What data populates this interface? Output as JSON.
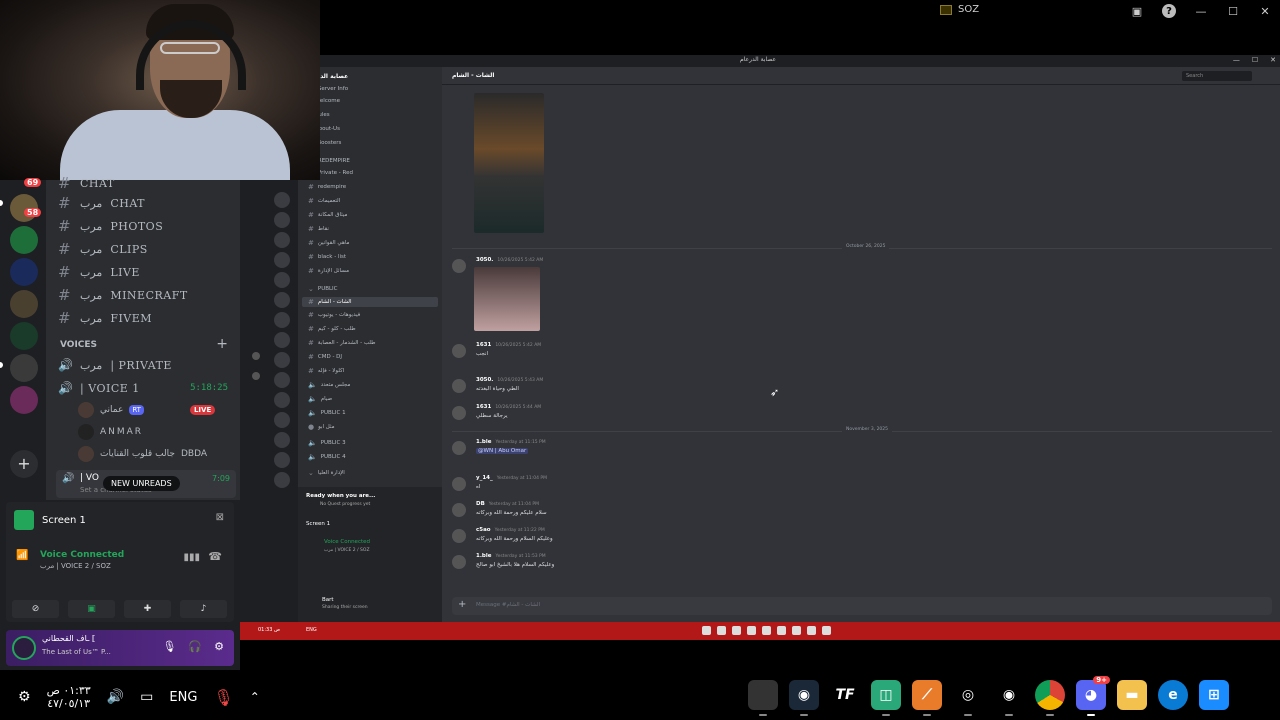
{
  "outer_window": {
    "title": "SOZ"
  },
  "left_panel": {
    "rail_badges": [
      "69",
      "58"
    ],
    "text_channels": [
      "CHAT",
      "CHAT",
      "PHOTOS",
      "CLIPS",
      "LIVE",
      "MINECRAFT",
      "FIVEM"
    ],
    "channel_prefix": "مرب",
    "voices_header": "VOICES",
    "voice_channels": [
      {
        "label": "| PRIVATE",
        "timer": ""
      },
      {
        "label": "| VOICE 1",
        "timer": "5:18:25"
      }
    ],
    "voice_users": [
      {
        "name": "عماني",
        "badge": "RT",
        "live": "LIVE"
      },
      {
        "name": "ANMAR"
      },
      {
        "name": "جالب قلوب القنايات",
        "badge": "DBDA"
      }
    ],
    "status_channel": "| VO",
    "status_timer": "7:09",
    "status_placeholder": "Set a channel status",
    "new_unreads": "NEW UNREADS",
    "screen_title": "Screen 1",
    "voice_connected": "Voice Connected",
    "voice_connected_sub": "مرب | VOICE 2 / SOZ",
    "user_name": "ـاف القحطاني ⟦",
    "user_game": "The Last of Us™ P..."
  },
  "discord_window": {
    "title": "عصابة الدرعام",
    "server_name": "عصابة الدرعام",
    "channels": [
      "Server Info",
      "Welcome",
      "Rules",
      "About-Us",
      "Boosters",
      "REDEMPIRE",
      "Private - Red",
      "redempire",
      "التعميمات",
      "ميثاق المكانة",
      "نقاط",
      "ماهي القوانين",
      "black - list",
      "مسائل الإدارة",
      "PUBLIC",
      "الشات - الشام",
      "فيديوهات - يوتيوب",
      "طلب - كلو - كيم",
      "طلب - الشدمار - العصابة",
      "CMD - DJ",
      "اكلولا - فإله",
      "مجلس متعدد",
      "صيام",
      "PUBLIC 1",
      "مثل ابو",
      "PUBLIC 3",
      "PUBLIC 4",
      "الإدارة العليا"
    ],
    "active_channel": "الشات - الشام",
    "ready_title": "Ready when you are...",
    "ready_sub": "No Quest progress yet",
    "screen": "Screen 1",
    "voice_connected": "Voice Connected",
    "voice_sub": "مرب | VOICE 2 / SOZ",
    "user": "Bart",
    "user_status": "Sharing their screen",
    "chat_header": "الشات - الشام",
    "search_placeholder": "Search",
    "dividers": [
      "October 26, 2025",
      "November 3, 2025"
    ],
    "messages": [
      {
        "name": "3050.",
        "time": "10/26/2025 5:42 AM",
        "text": ""
      },
      {
        "name": "1631",
        "time": "10/26/2025 5:42 AM",
        "text": "انجب"
      },
      {
        "name": "3050.",
        "time": "10/26/2025 5:43 AM",
        "text": "الطي وحياة البغدته"
      },
      {
        "name": "1631",
        "time": "10/26/2025 5:44 AM",
        "text": "يرجالة سطلي"
      },
      {
        "name": "1.ble",
        "time": "Yesterday at 11:15 PM",
        "text": "@WN | Abu Omar"
      },
      {
        "name": "y_14_",
        "time": "Yesterday at 11:04 PM",
        "text": "اه"
      },
      {
        "name": "DB",
        "time": "Yesterday at 11:04 PM",
        "text": "سلام عليكم ورحمة الله وبركاته"
      },
      {
        "name": "c5ao",
        "time": "Yesterday at 11:22 PM",
        "text": "وعليكم السلام ورحمة الله وبركاته"
      },
      {
        "name": "1.ble",
        "time": "Yesterday at 11:53 PM",
        "text": "وعليكم السلام هلا بالشيخ ابو صالح"
      }
    ],
    "composer_placeholder": "Message #الشات - الشام",
    "taskbar_lang": "ENG",
    "taskbar_date": "01:33 ص"
  },
  "taskbar": {
    "time": "٠١:٣٣ ص",
    "date": "٤٧/٠٥/١٣",
    "lang": "ENG",
    "discord_badge": "9+"
  }
}
